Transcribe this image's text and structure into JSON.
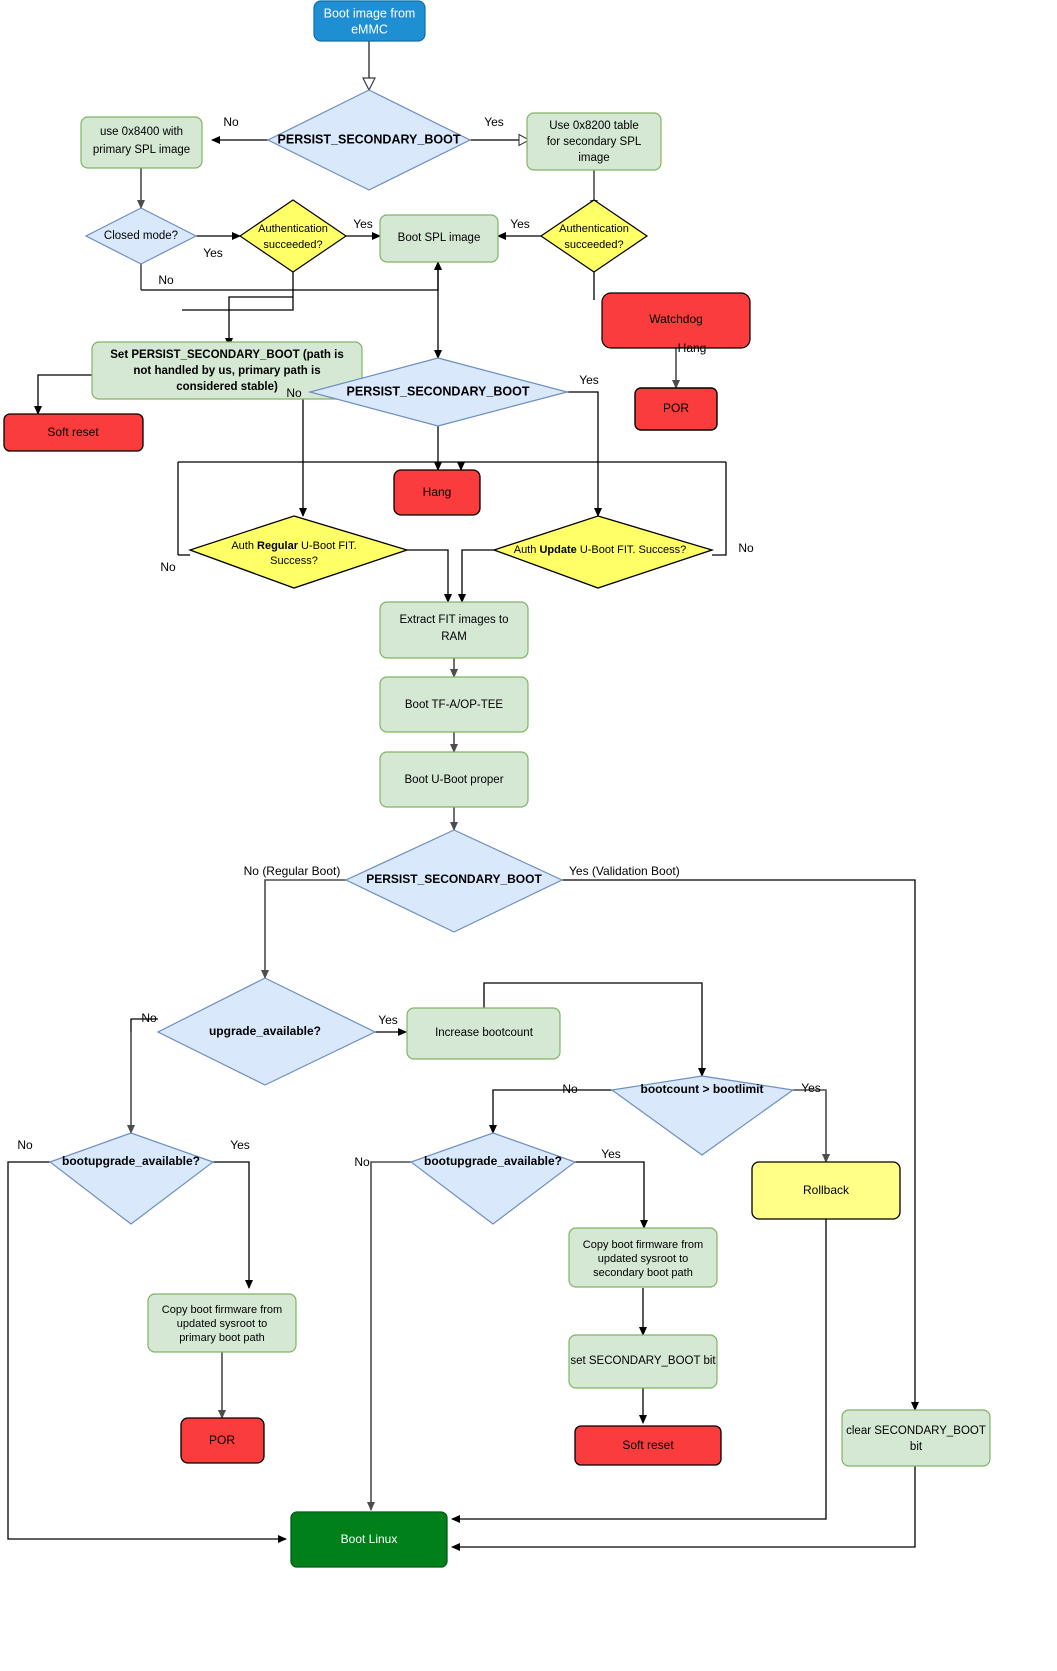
{
  "diagram": {
    "title": "eMMC secondary boot / U-Boot FIT authentication flowchart",
    "colors": {
      "start_fill": "#1f8fd4",
      "start_stroke": "#0d6fa8",
      "start_text": "#ffffff",
      "process_fill": "#d5e8d4",
      "process_stroke": "#82b366",
      "decision_fill": "#dae8fc",
      "decision_stroke": "#6c8ebf",
      "auth_fill": "#ffff66",
      "auth_stroke": "#000000",
      "error_fill": "#fa3c3c",
      "error_stroke": "#000000",
      "rollback_fill": "#ffff88",
      "rollback_stroke": "#000000",
      "linux_fill": "#00801a",
      "linux_stroke": "#005c13",
      "linux_text": "#ffffff",
      "edge": "#000000",
      "edge_grey": "#4d4d4d"
    },
    "nodes": {
      "boot_image_emmc": {
        "lines": [
          "Boot image from",
          "eMMC"
        ]
      },
      "persist_secondary_boot_1": {
        "lines": [
          "PERSIST_SECONDARY_BOOT"
        ]
      },
      "use_0x8400": {
        "lines": [
          "use 0x8400 with",
          "primary SPL image"
        ]
      },
      "use_0x8200": {
        "lines": [
          "Use 0x8200 table",
          "for secondary SPL",
          "image"
        ]
      },
      "closed_mode": {
        "lines": [
          "Closed mode?"
        ]
      },
      "auth_succeeded_left": {
        "lines": [
          "Authentication",
          "succeeded?"
        ]
      },
      "auth_succeeded_right": {
        "lines": [
          "Authentication",
          "succeeded?"
        ]
      },
      "boot_spl_image": {
        "lines": [
          "Boot SPL image"
        ]
      },
      "watchdog": {
        "lines": [
          "Watchdog"
        ]
      },
      "por_top": {
        "lines": [
          "POR"
        ]
      },
      "set_persist": {
        "prefix": "Set ",
        "bold": "PERSIST_SECONDARY_BOOT (path is not handled by us, primary path is considered stable)",
        "lines_plain": [
          "Set ",
          "",
          ""
        ],
        "lines": [
          "Set PERSIST_SECONDARY_BOOT (path is",
          "not handled by us, primary path is",
          "considered stable)"
        ]
      },
      "soft_reset_top": {
        "lines": [
          "Soft reset"
        ]
      },
      "persist_secondary_boot_2": {
        "lines": [
          "PERSIST_SECONDARY_BOOT"
        ]
      },
      "hang": {
        "lines": [
          "Hang"
        ]
      },
      "auth_regular": {
        "pre": "Auth ",
        "bold": "Regular",
        "post": " U-Boot FIT.",
        "line2": "Success?"
      },
      "auth_update": {
        "pre": "Auth ",
        "bold": "Update",
        "post": " U-Boot FIT. Success?"
      },
      "extract_fit": {
        "lines": [
          "Extract FIT images to",
          "RAM"
        ]
      },
      "boot_tfa_optee": {
        "lines": [
          "Boot TF-A/OP-TEE"
        ]
      },
      "boot_uboot_proper": {
        "lines": [
          "Boot U-Boot proper"
        ]
      },
      "persist_secondary_boot_3": {
        "lines": [
          "PERSIST_SECONDARY_BOOT"
        ]
      },
      "upgrade_available": {
        "lines": [
          "upgrade_available?"
        ]
      },
      "increase_bootcount": {
        "lines": [
          "Increase bootcount"
        ]
      },
      "bootcount_gt_bootlimit": {
        "lines": [
          "bootcount > bootlimit"
        ]
      },
      "bootupgrade_available_left": {
        "lines": [
          "bootupgrade_available?"
        ]
      },
      "bootupgrade_available_right": {
        "lines": [
          "bootupgrade_available?"
        ]
      },
      "rollback": {
        "lines": [
          "Rollback"
        ]
      },
      "copy_primary": {
        "lines": [
          "Copy boot firmware from",
          "updated sysroot to",
          "primary boot path"
        ]
      },
      "copy_secondary": {
        "lines": [
          "Copy boot firmware from",
          "updated sysroot to",
          "secondary boot path"
        ]
      },
      "set_secondary_bit": {
        "lines": [
          "set SECONDARY_BOOT bit"
        ]
      },
      "soft_reset_bottom": {
        "lines": [
          "Soft reset"
        ]
      },
      "por_bottom": {
        "lines": [
          "POR"
        ]
      },
      "clear_secondary_bit": {
        "lines": [
          "clear SECONDARY_BOOT",
          "bit"
        ]
      },
      "boot_linux": {
        "lines": [
          "Boot Linux"
        ]
      }
    },
    "edge_labels": {
      "psb1_no": "No",
      "psb1_yes": "Yes",
      "closed_mode_yes": "Yes",
      "closed_mode_no": "No",
      "auth_left_yes": "Yes",
      "auth_right_yes": "Yes",
      "watchdog_hang": "Hang",
      "psb2_no": "No",
      "psb2_yes": "Yes",
      "auth_regular_no": "No",
      "auth_update_no": "No",
      "psb3_no": "No (Regular Boot)",
      "psb3_yes": "Yes (Validation Boot)",
      "upgrade_no": "No",
      "upgrade_yes": "Yes",
      "bootcount_no": "No",
      "bootcount_yes": "Yes",
      "bootupgrade_left_no": "No",
      "bootupgrade_left_yes": "Yes",
      "bootupgrade_right_no": "No",
      "bootupgrade_right_yes": "Yes"
    }
  }
}
